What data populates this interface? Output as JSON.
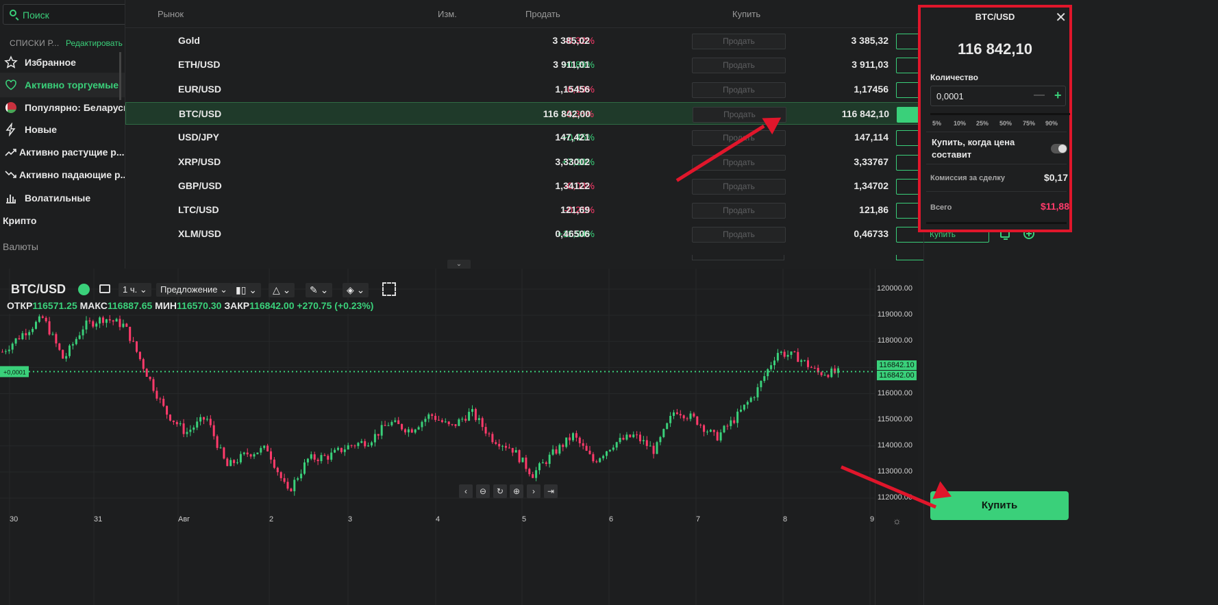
{
  "sidebar": {
    "search_placeholder": "Поиск",
    "lists_title": "СПИСКИ Р...",
    "edit_label": "Редактировать",
    "items": [
      {
        "label": "Избранное",
        "icon": "star-icon"
      },
      {
        "label": "Активно торгуемые",
        "icon": "heart-icon"
      },
      {
        "label": "Популярно: Беларусь",
        "icon": "flag-belarus-icon"
      },
      {
        "label": "Новые",
        "icon": "lightning-icon"
      },
      {
        "label": "Активно растущие р...",
        "icon": "trend-up-icon"
      },
      {
        "label": "Активно падающие р...",
        "icon": "trend-down-icon"
      },
      {
        "label": "Волатильные",
        "icon": "bars-icon"
      }
    ],
    "section_crypto": "Крипто",
    "section_fx": "Валюты"
  },
  "table": {
    "headers": {
      "market": "Рынок",
      "change": "Изм.",
      "sell": "Продать",
      "buy": "Купить"
    },
    "sell_btn": "Продать",
    "buy_btn": "Купить",
    "rows": [
      {
        "sym": "Gold",
        "chg": "-0,32%",
        "bid": "3 385,02",
        "ask": "3 385,32",
        "status": "check"
      },
      {
        "sym": "ETH/USD",
        "chg": "+0,89%",
        "bid": "3 911,01",
        "ask": "3 911,03",
        "status": "check"
      },
      {
        "sym": "EUR/USD",
        "chg": "-0,19%",
        "bid": "1,15456",
        "ask": "1,17456",
        "status": "plus"
      },
      {
        "sym": "BTC/USD",
        "chg": "-0,36%",
        "bid": "116 842,00",
        "ask": "116 842,10",
        "status": "check"
      },
      {
        "sym": "USD/JPY",
        "chg": "+0,45%",
        "bid": "147,421",
        "ask": "147,114",
        "status": "plus"
      },
      {
        "sym": "XRP/USD",
        "chg": "+7,20%",
        "bid": "3,33002",
        "ask": "3,33767",
        "status": "plus"
      },
      {
        "sym": "GBP/USD",
        "chg": "-0,03%",
        "bid": "1,34122",
        "ask": "1,34702",
        "status": "plus"
      },
      {
        "sym": "LTC/USD",
        "chg": "-0,21%",
        "bid": "121,69",
        "ask": "121,86",
        "status": "plus"
      },
      {
        "sym": "XLM/USD",
        "chg": "+11,94%",
        "bid": "0,46506",
        "ask": "0,46733",
        "status": "plus"
      }
    ]
  },
  "order": {
    "pair": "BTC/USD",
    "price": "116 842,10",
    "qty_label": "Количество",
    "qty_value": "0,0001",
    "percents": [
      "5%",
      "10%",
      "25%",
      "50%",
      "75%",
      "90%"
    ],
    "limit_label": "Купить, когда цена составит",
    "fee_label": "Комиссия за сделку",
    "fee_value": "$0,17",
    "total_label": "Всего",
    "total_value": "$11,88",
    "buy_button": "Купить"
  },
  "chart": {
    "symbol": "BTC/USD",
    "timeframe": "1 ч.",
    "price_type": "Предложение",
    "ohlc": {
      "o_label": "ОТКР",
      "o": "116571.25",
      "h_label": "МАКС",
      "h": "116887.65",
      "l_label": "МИН",
      "l": "116570.30",
      "c_label": "ЗАКР",
      "c": "116842.00",
      "change": "+270.75 (+0.23%)"
    },
    "y_ticks": [
      "120000.00",
      "119000.00",
      "118000.00",
      "117000.00",
      "116000.00",
      "115000.00",
      "114000.00",
      "113000.00",
      "112000.00"
    ],
    "price_labels": [
      "116842.10",
      "116842.00"
    ],
    "spread_label": "+0,0001",
    "x_ticks": [
      "30",
      "31",
      "Авг",
      "2",
      "3",
      "4",
      "5",
      "6",
      "7",
      "8",
      "9"
    ]
  },
  "chart_data": {
    "type": "candlestick",
    "x_labels": [
      "30",
      "31",
      "Авг",
      "2",
      "3",
      "4",
      "5",
      "6",
      "7",
      "8",
      "9"
    ],
    "ylim": [
      111700,
      120300
    ],
    "current_price": 116842,
    "path": [
      117600,
      118300,
      118900,
      117300,
      118600,
      118900,
      118600,
      116900,
      115300,
      114500,
      115100,
      113200,
      113700,
      113900,
      112200,
      113500,
      113600,
      114000,
      114200,
      114900,
      114600,
      115200,
      114700,
      115300,
      114300,
      113900,
      112900,
      113700,
      114400,
      113400,
      114100,
      114400,
      113800,
      115400,
      115000,
      114300,
      115100,
      116100,
      117600,
      117400,
      116800,
      116800
    ]
  },
  "colors": {
    "accent": "#3ad07a",
    "negative": "#ff3b6b",
    "annotation": "#e0162b"
  }
}
